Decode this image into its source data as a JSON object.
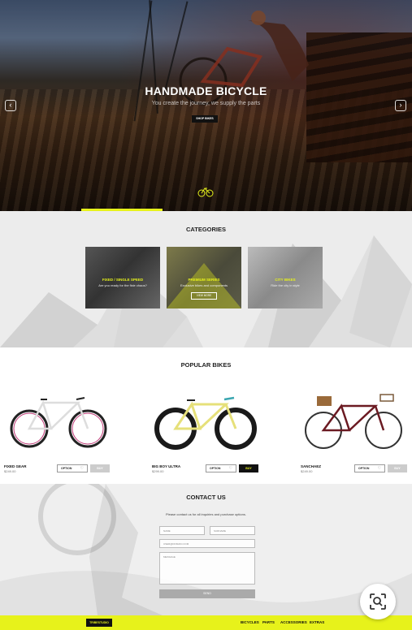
{
  "hero": {
    "title": "HANDMADE BICYCLE",
    "subtitle": "You create the journey, we supply the parts",
    "cta": "SHOP BIKES",
    "prev_icon": "chevron-left-icon",
    "next_icon": "chevron-right-icon"
  },
  "categories": {
    "title": "CATEGORIES",
    "items": [
      {
        "label": "FIXED / SINGLE SPEED",
        "desc": "Are you ready for the fixie chaos?"
      },
      {
        "label": "PREMIUM SERIES",
        "desc": "Exclusive bikes and components",
        "more": "VIEW MORE"
      },
      {
        "label": "CITY BIKES",
        "desc": "Ride the city in style"
      }
    ]
  },
  "popular": {
    "title": "POPULAR BIKES",
    "bikes": [
      {
        "name": "FIXED GEAR",
        "price": "$249.00",
        "option": "OPTION",
        "buy": "BUY"
      },
      {
        "name": "BIG BOY ULTRA",
        "price": "$299.00",
        "option": "OPTION",
        "buy": "BUY"
      },
      {
        "name": "SANCHAEZ",
        "price": "$249.00",
        "option": "OPTION",
        "buy": "BUY"
      }
    ]
  },
  "contact": {
    "title": "CONTACT US",
    "description": "Please contact us for all inquiries and purchase options.",
    "name_placeholder": "NAME",
    "surname_placeholder": "SURNAME",
    "email_placeholder": "USER@DOMAIN.COM",
    "message_placeholder": "MESSAGE",
    "send": "SEND"
  },
  "footer": {
    "logo": "TRIBESTUDIO",
    "nav": [
      "BICYCLES",
      "PARTS",
      "ACCESSORIES",
      "EXTRAS"
    ]
  },
  "colors": {
    "accent": "#e7f21b",
    "dark": "#111111"
  }
}
